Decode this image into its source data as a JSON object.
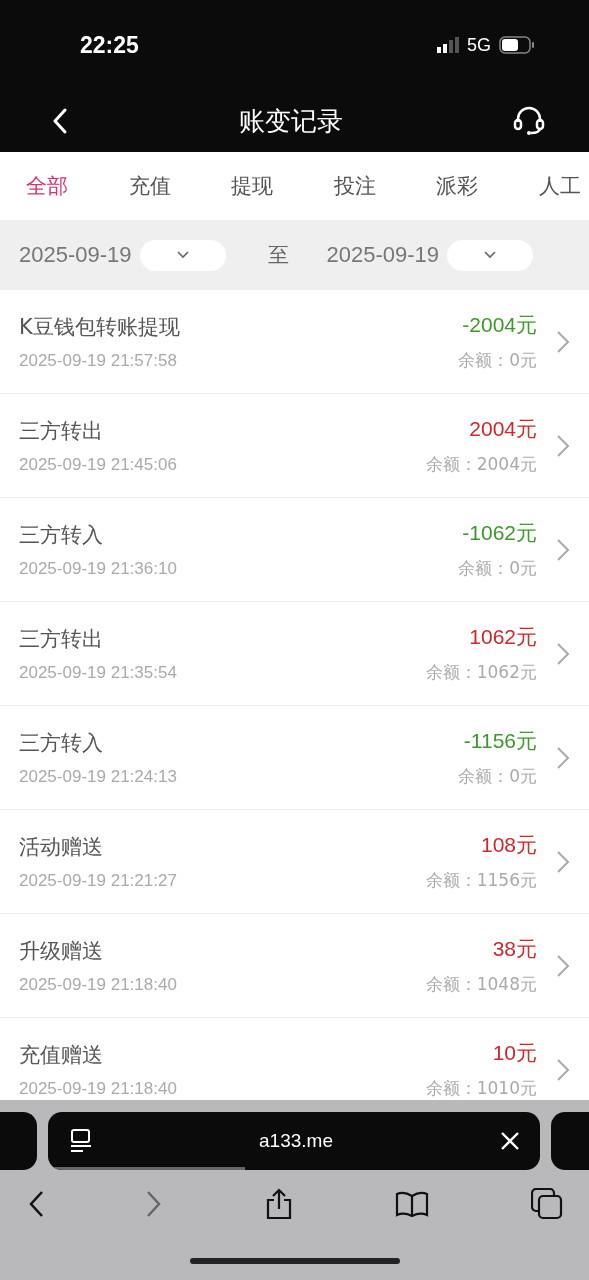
{
  "status_bar": {
    "time": "22:25",
    "network": "5G"
  },
  "header": {
    "title": "账变记录"
  },
  "tabs": [
    {
      "label": "全部",
      "selected": true
    },
    {
      "label": "充值",
      "selected": false
    },
    {
      "label": "提现",
      "selected": false
    },
    {
      "label": "投注",
      "selected": false
    },
    {
      "label": "派彩",
      "selected": false
    },
    {
      "label": "人工",
      "selected": false
    }
  ],
  "date_filter": {
    "start": "2025-09-19",
    "separator": "至",
    "end": "2025-09-19"
  },
  "records": [
    {
      "title": "K豆钱包转账提现",
      "time": "2025-09-19 21:57:58",
      "amount": "-2004元",
      "color": "#3d9a2a",
      "balance": "余额：0元"
    },
    {
      "title": "三方转出",
      "time": "2025-09-19 21:45:06",
      "amount": "2004元",
      "color": "#d0262c",
      "balance": "余额：2004元"
    },
    {
      "title": "三方转入",
      "time": "2025-09-19 21:36:10",
      "amount": "-1062元",
      "color": "#3d9a2a",
      "balance": "余额：0元"
    },
    {
      "title": "三方转出",
      "time": "2025-09-19 21:35:54",
      "amount": "1062元",
      "color": "#d0262c",
      "balance": "余额：1062元"
    },
    {
      "title": "三方转入",
      "time": "2025-09-19 21:24:13",
      "amount": "-1156元",
      "color": "#3d9a2a",
      "balance": "余额：0元"
    },
    {
      "title": "活动赠送",
      "time": "2025-09-19 21:21:27",
      "amount": "108元",
      "color": "#d0262c",
      "balance": "余额：1156元"
    },
    {
      "title": "升级赠送",
      "time": "2025-09-19 21:18:40",
      "amount": "38元",
      "color": "#d0262c",
      "balance": "余额：1048元"
    },
    {
      "title": "充值赠送",
      "time": "2025-09-19 21:18:40",
      "amount": "10元",
      "color": "#d0262c",
      "balance": "余额：1010元"
    }
  ],
  "browser": {
    "url": "a133.me"
  }
}
